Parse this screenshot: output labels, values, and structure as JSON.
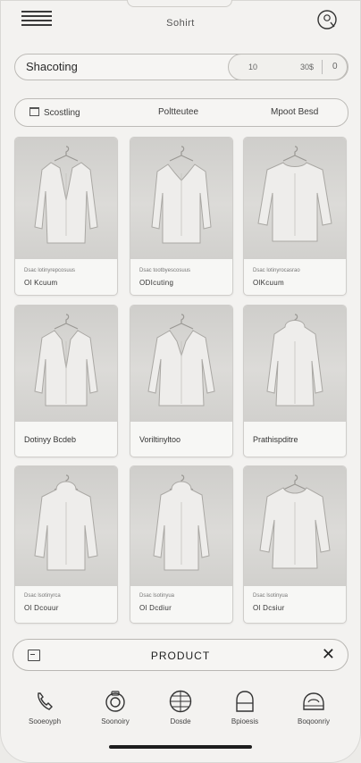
{
  "header": {
    "title": "Sohirt"
  },
  "search": {
    "value": "Shacoting"
  },
  "range": {
    "min": "10",
    "max": "30$",
    "reset": "0"
  },
  "filters": [
    {
      "label": "Scostling",
      "icon": "filter-icon"
    },
    {
      "label": "Poltteutee"
    },
    {
      "label": "Mpoot Besd"
    }
  ],
  "products": [
    {
      "meta": "Dsac  lotinyrepcosuus",
      "price": "Ol Kcuum",
      "name": "",
      "garment": "coat-long"
    },
    {
      "meta": "Dsac  tootbyescosuus",
      "price": "ODIcuting",
      "name": "",
      "garment": "peacoat"
    },
    {
      "meta": "Dsac  lotinyrocasrao",
      "price": "OlKcuum",
      "name": "",
      "garment": "sweater"
    },
    {
      "meta": "",
      "price": "",
      "name": "Dotinyy Bcdeb",
      "garment": "blazer"
    },
    {
      "meta": "",
      "price": "",
      "name": "Voriltinyltoo",
      "garment": "trench"
    },
    {
      "meta": "",
      "price": "",
      "name": "Prathispditre",
      "garment": "parka"
    },
    {
      "meta": "Dsac  lsotinyrca",
      "price": "Ol Dcouur",
      "name": "",
      "garment": "hoodie"
    },
    {
      "meta": "Dsac  lsotinyua",
      "price": "Ol Dcdiur",
      "name": "",
      "garment": "zip-hoodie"
    },
    {
      "meta": "Dsac  lsotinyua",
      "price": "Ol Dcsiur",
      "name": "",
      "garment": "knit-sweater"
    }
  ],
  "product_bar": {
    "label": "PRODUCT",
    "close": "✕",
    "icon": "list-icon"
  },
  "nav": [
    {
      "label": "Sooeoyph",
      "icon": "phone-icon"
    },
    {
      "label": "Soonoiry",
      "icon": "camera-icon"
    },
    {
      "label": "Dosde",
      "icon": "globe-icon"
    },
    {
      "label": "Bpioesis",
      "icon": "bag-icon"
    },
    {
      "label": "Boqoonriy",
      "icon": "cloud-icon"
    }
  ]
}
